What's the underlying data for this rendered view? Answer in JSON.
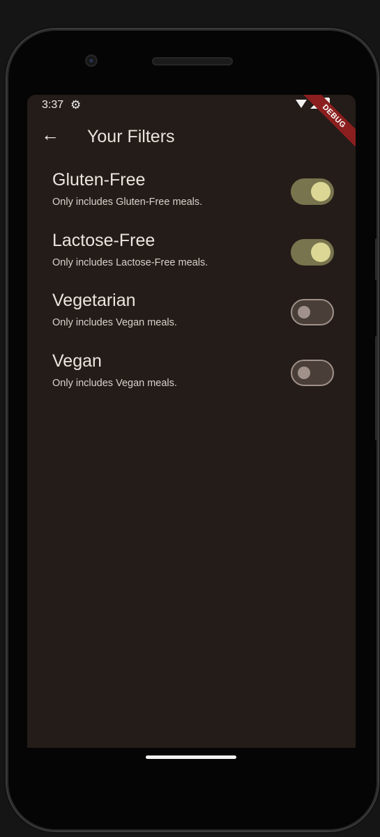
{
  "status_bar": {
    "time": "3:37",
    "settings_icon": "gear-icon",
    "wifi_icon": "wifi-icon",
    "signal_icon": "cell-signal-icon",
    "battery_icon": "battery-icon",
    "debug_banner": "DEBUG"
  },
  "app_bar": {
    "back_icon": "arrow-back-icon",
    "title": "Your Filters"
  },
  "filters": [
    {
      "title": "Gluten-Free",
      "subtitle": "Only includes Gluten-Free meals.",
      "enabled": true
    },
    {
      "title": "Lactose-Free",
      "subtitle": "Only includes Lactose-Free meals.",
      "enabled": true
    },
    {
      "title": "Vegetarian",
      "subtitle": "Only includes Vegan meals.",
      "enabled": false
    },
    {
      "title": "Vegan",
      "subtitle": "Only includes Vegan meals.",
      "enabled": false
    }
  ],
  "colors": {
    "background": "#241c18",
    "switch_on_track": "#78744e",
    "switch_on_thumb": "#dcd795",
    "switch_off_track": "#4a3e39",
    "switch_off_thumb": "#a0928a",
    "debug_banner": "#8b1f1f"
  }
}
